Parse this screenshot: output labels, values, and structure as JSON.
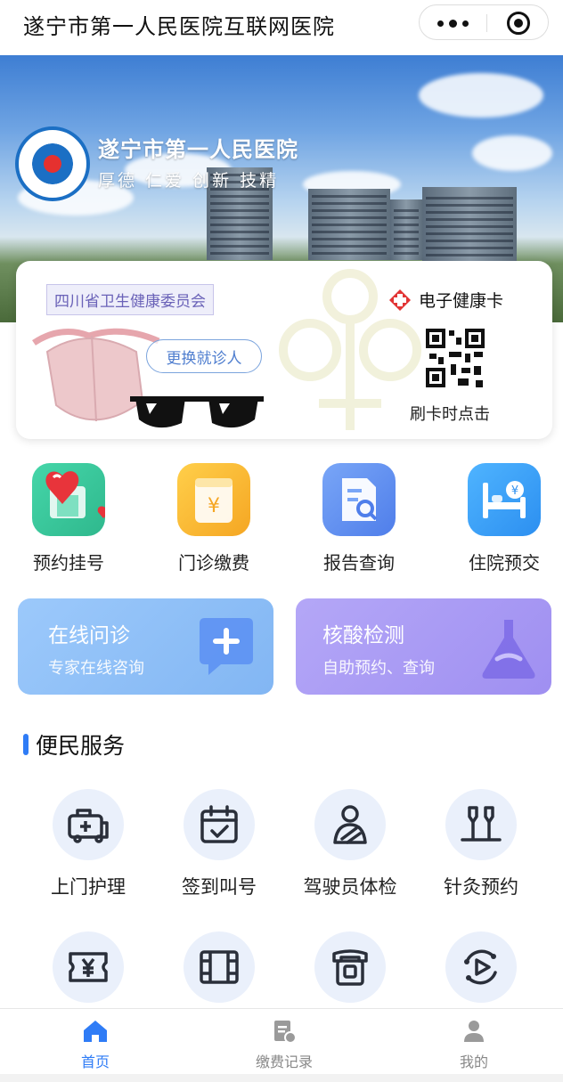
{
  "header": {
    "title": "遂宁市第一人民医院互联网医院"
  },
  "banner": {
    "hospital_name": "遂宁市第一人民医院",
    "motto": "厚德 仁爱 创新 技精"
  },
  "card": {
    "tag": "四川省卫生健康委员会",
    "switch_label": "更换就诊人",
    "health_card_label": "电子健康卡",
    "swipe_hint": "刷卡时点击"
  },
  "quick": [
    {
      "label": "预约挂号",
      "icon": "appointment-icon",
      "color": "#35c39a"
    },
    {
      "label": "门诊缴费",
      "icon": "payment-icon",
      "color": "#f8b733"
    },
    {
      "label": "报告查询",
      "icon": "report-icon",
      "color": "#5f8ef0"
    },
    {
      "label": "住院预交",
      "icon": "hospital-bed-icon",
      "color": "#3a9cf5"
    }
  ],
  "bigcards": [
    {
      "title": "在线问诊",
      "subtitle": "专家在线咨询",
      "color": "#8ec0f7"
    },
    {
      "title": "核酸检测",
      "subtitle": "自助预约、查询",
      "color": "#a99af4"
    }
  ],
  "section": {
    "title": "便民服务"
  },
  "services": [
    {
      "label": "上门护理",
      "icon": "ambulance-icon"
    },
    {
      "label": "签到叫号",
      "icon": "calendar-check-icon"
    },
    {
      "label": "驾驶员体检",
      "icon": "driver-icon"
    },
    {
      "label": "针灸预约",
      "icon": "acupuncture-icon"
    },
    {
      "label": "",
      "icon": "ticket-yen-icon"
    },
    {
      "label": "",
      "icon": "film-icon"
    },
    {
      "label": "",
      "icon": "phone-icon"
    },
    {
      "label": "",
      "icon": "video-play-icon"
    }
  ],
  "tabs": [
    {
      "label": "首页",
      "icon": "home-icon",
      "active": true
    },
    {
      "label": "缴费记录",
      "icon": "bill-icon",
      "active": false
    },
    {
      "label": "我的",
      "icon": "user-icon",
      "active": false
    }
  ]
}
